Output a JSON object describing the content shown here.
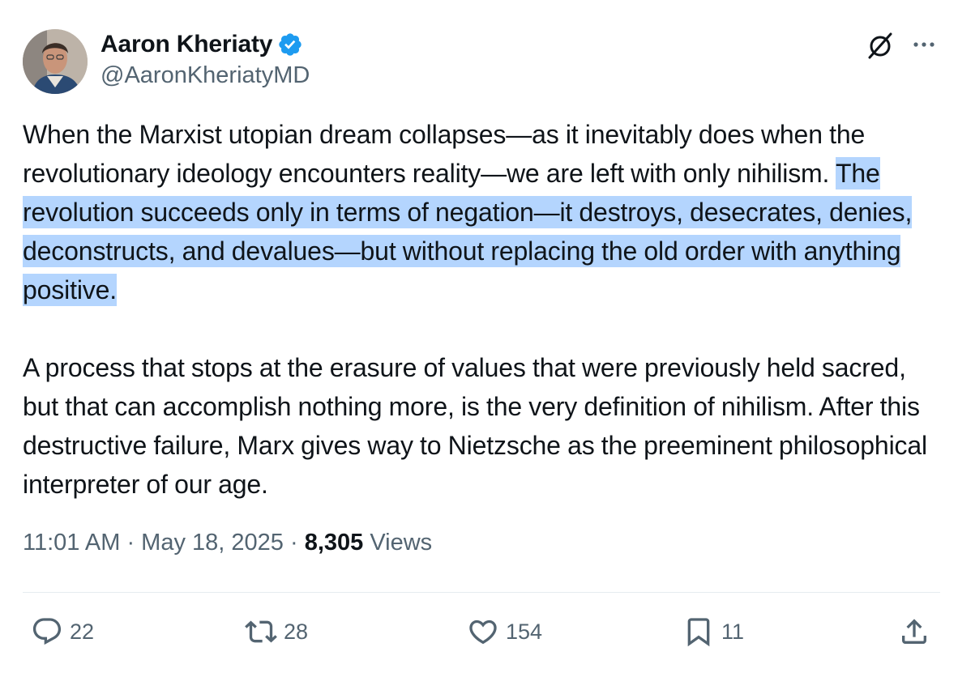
{
  "author": {
    "display_name": "Aaron Kheriaty",
    "handle": "@AaronKheriatyMD",
    "verified": true,
    "verified_color": "#1d9bf0"
  },
  "header_icons": [
    "grok-icon",
    "more-icon"
  ],
  "tweet": {
    "paragraph1_plain": "When the Marxist utopian dream collapses—as it inevitably does when the revolutionary ideology encounters reality—we are left with only nihilism. ",
    "paragraph1_highlighted": "The revolution succeeds only in terms of negation—it destroys, desecrates, denies, deconstructs, and devalues—but without replacing the old order with anything positive.",
    "paragraph2": "A process that stops at the erasure of values that were previously held sacred, but that can accomplish nothing more, is the very definition of nihilism. After this destructive failure, Marx gives way to Nietzsche as the preeminent philosophical interpreter of our age.",
    "highlight_color": "#b4d5fe"
  },
  "meta": {
    "time": "11:01 AM",
    "separator": " · ",
    "date": "May 18, 2025",
    "views_count": "8,305",
    "views_label": " Views"
  },
  "actions": {
    "replies": "22",
    "reposts": "28",
    "likes": "154",
    "bookmarks": "11",
    "icons": [
      "reply-icon",
      "repost-icon",
      "like-icon",
      "bookmark-icon",
      "share-icon"
    ]
  }
}
